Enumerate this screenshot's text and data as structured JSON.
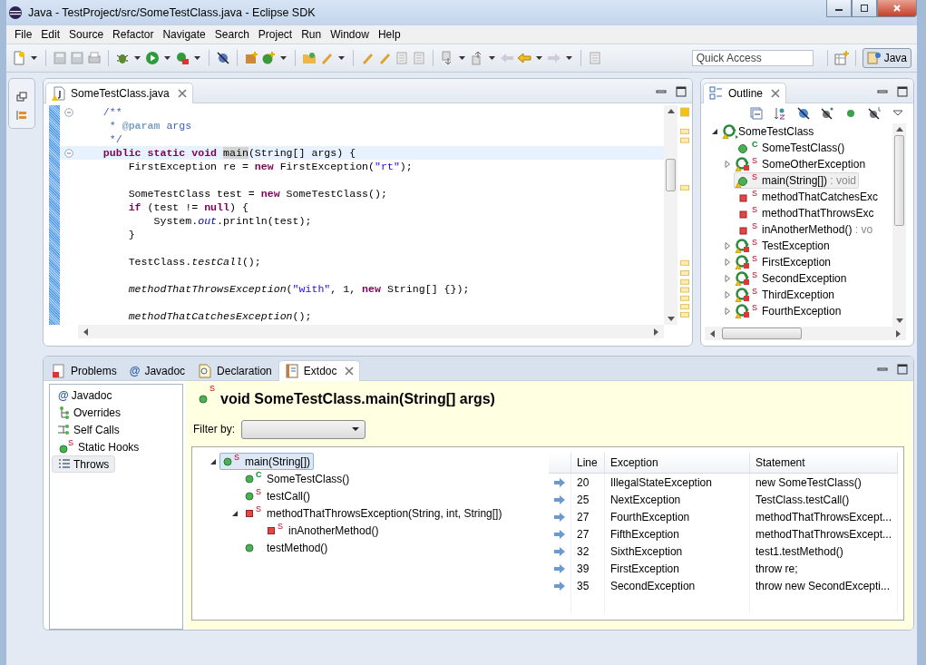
{
  "window": {
    "title": "Java - TestProject/src/SomeTestClass.java - Eclipse SDK"
  },
  "menu": [
    {
      "label": "File"
    },
    {
      "label": "Edit"
    },
    {
      "label": "Source"
    },
    {
      "label": "Refactor"
    },
    {
      "label": "Navigate"
    },
    {
      "label": "Search"
    },
    {
      "label": "Project"
    },
    {
      "label": "Run"
    },
    {
      "label": "Window"
    },
    {
      "label": "Help"
    }
  ],
  "quick_access": {
    "placeholder": "Quick Access"
  },
  "perspective": {
    "label": "Java",
    "selected": true
  },
  "editor": {
    "tab": {
      "label": "SomeTestClass.java",
      "selected": true,
      "warning": true
    },
    "lines": [
      {
        "fold": true,
        "current": false,
        "segments": [
          {
            "kind": "comment",
            "text": "    /**"
          }
        ]
      },
      {
        "current": false,
        "segments": [
          {
            "kind": "comment",
            "text": "     * "
          },
          {
            "kind": "tag",
            "text": "@param"
          },
          {
            "kind": "comment",
            "text": " args"
          }
        ]
      },
      {
        "current": false,
        "segments": [
          {
            "kind": "comment",
            "text": "     */"
          }
        ]
      },
      {
        "fold": true,
        "current": true,
        "segments": [
          {
            "kind": "keyword",
            "text": "    public static void "
          },
          {
            "kind": "plain",
            "text": "main",
            "occurrence": true
          },
          {
            "kind": "plain",
            "text": "(String[] args) {"
          }
        ]
      },
      {
        "current": false,
        "segments": [
          {
            "kind": "plain",
            "text": "        FirstException re = "
          },
          {
            "kind": "keyword",
            "text": "new"
          },
          {
            "kind": "plain",
            "text": " FirstException("
          },
          {
            "kind": "string",
            "text": "\"rt\""
          },
          {
            "kind": "plain",
            "text": ");"
          }
        ]
      },
      {
        "current": false
      },
      {
        "current": false,
        "segments": [
          {
            "kind": "plain",
            "text": "        SomeTestClass test = "
          },
          {
            "kind": "keyword",
            "text": "new"
          },
          {
            "kind": "plain",
            "text": " SomeTestClass();"
          }
        ]
      },
      {
        "current": false,
        "segments": [
          {
            "kind": "keyword",
            "text": "        if"
          },
          {
            "kind": "plain",
            "text": " (test != "
          },
          {
            "kind": "keyword",
            "text": "null"
          },
          {
            "kind": "plain",
            "text": ") {"
          }
        ]
      },
      {
        "current": false,
        "segments": [
          {
            "kind": "plain",
            "text": "            System."
          },
          {
            "kind": "field",
            "text": "out"
          },
          {
            "kind": "plain",
            "text": ".println(test);"
          }
        ]
      },
      {
        "current": false,
        "segments": [
          {
            "kind": "plain",
            "text": "        }"
          }
        ]
      },
      {
        "current": false
      },
      {
        "current": false,
        "segments": [
          {
            "kind": "plain",
            "text": "        TestClass."
          },
          {
            "kind": "static",
            "text": "testCall"
          },
          {
            "kind": "plain",
            "text": "();"
          }
        ]
      },
      {
        "current": false
      },
      {
        "current": false,
        "segments": [
          {
            "kind": "static",
            "text": "        methodThatThrowsException"
          },
          {
            "kind": "plain",
            "text": "("
          },
          {
            "kind": "string",
            "text": "\"with\""
          },
          {
            "kind": "plain",
            "text": ", 1, "
          },
          {
            "kind": "keyword",
            "text": "new"
          },
          {
            "kind": "plain",
            "text": " String[] {});"
          }
        ]
      },
      {
        "current": false
      },
      {
        "current": false,
        "segments": [
          {
            "kind": "static",
            "text": "        methodThatCatchesException"
          },
          {
            "kind": "plain",
            "text": "();"
          }
        ]
      }
    ]
  },
  "outline": {
    "title": "Outline",
    "items": [
      {
        "label": "SomeTestClass",
        "kind": "class",
        "warning": true,
        "selected": false,
        "expanded": true,
        "children": [
          {
            "label": "SomeTestClass()",
            "kind": "public",
            "badge": "C",
            "warning": false,
            "selected": false
          },
          {
            "label": "SomeOtherException",
            "kind": "type",
            "badge": "S",
            "warning": true,
            "selected": false,
            "expanded": false
          },
          {
            "label": "main(String[])",
            "suffix": " : void",
            "kind": "public",
            "badge": "S",
            "warning": true,
            "selected": true
          },
          {
            "label": "methodThatCatchesExc",
            "kind": "private",
            "badge": "S",
            "warning": false,
            "selected": false
          },
          {
            "label": "methodThatThrowsExc",
            "kind": "private",
            "badge": "S",
            "warning": false,
            "selected": false
          },
          {
            "label": "inAnotherMethod()",
            "suffix": " : vo",
            "kind": "private",
            "badge": "S",
            "warning": false,
            "selected": false
          },
          {
            "label": "TestException",
            "kind": "type",
            "badge": "S",
            "warning": true,
            "selected": false,
            "expanded": false
          },
          {
            "label": "FirstException",
            "kind": "type",
            "badge": "S",
            "warning": true,
            "selected": false,
            "expanded": false
          },
          {
            "label": "SecondException",
            "kind": "type",
            "badge": "S",
            "warning": true,
            "selected": false,
            "expanded": false
          },
          {
            "label": "ThirdException",
            "kind": "type",
            "badge": "S",
            "warning": true,
            "selected": false,
            "expanded": false
          },
          {
            "label": "FourthException",
            "kind": "type",
            "badge": "S",
            "warning": true,
            "selected": false,
            "expanded": false
          }
        ]
      }
    ]
  },
  "bottom": {
    "tabs": [
      {
        "label": "Problems",
        "kind": "problems",
        "selected": false
      },
      {
        "label": "Javadoc",
        "kind": "glyph",
        "glyph": "@",
        "selected": false
      },
      {
        "label": "Declaration",
        "kind": "declaration",
        "selected": false
      },
      {
        "label": "Extdoc",
        "kind": "extdoc",
        "selected": true
      }
    ],
    "views": [
      {
        "label": "Javadoc",
        "kind": "glyph",
        "glyph": "@",
        "selected": false
      },
      {
        "label": "Overrides",
        "kind": "hierarchy",
        "selected": false
      },
      {
        "label": "Self Calls",
        "kind": "calls",
        "selected": false
      },
      {
        "label": "Static Hooks",
        "kind": "hook",
        "badge": "S",
        "selected": false
      },
      {
        "label": "Throws",
        "kind": "list",
        "selected": true
      }
    ],
    "heading": {
      "kind": "public",
      "badge": "S",
      "text": "void SomeTestClass.main(String[] args)"
    },
    "filter": {
      "label": "Filter by:"
    },
    "tree": [
      {
        "label": "main(String[])",
        "kind": "public",
        "badge": "S",
        "selected": true,
        "expanded": true,
        "children": [
          {
            "label": "SomeTestClass()",
            "kind": "public",
            "badge": "C",
            "selected": false
          },
          {
            "label": "testCall()",
            "kind": "public",
            "badge": "S",
            "selected": false
          },
          {
            "label": "methodThatThrowsException(String, int, String[])",
            "kind": "private",
            "badge": "S",
            "selected": false,
            "expanded": true,
            "children": [
              {
                "label": "inAnotherMethod()",
                "kind": "private",
                "badge": "S",
                "selected": false
              }
            ]
          },
          {
            "label": "testMethod()",
            "kind": "public",
            "selected": false
          }
        ]
      }
    ],
    "table": {
      "columns": [
        "Line",
        "Exception",
        "Statement"
      ],
      "rows": [
        {
          "line": "20",
          "exception": "IllegalStateException",
          "statement": "new SomeTestClass()"
        },
        {
          "line": "25",
          "exception": "NextException",
          "statement": "TestClass.testCall()"
        },
        {
          "line": "27",
          "exception": "FourthException",
          "statement": "methodThatThrowsExcept..."
        },
        {
          "line": "27",
          "exception": "FifthException",
          "statement": "methodThatThrowsExcept..."
        },
        {
          "line": "32",
          "exception": "SixthException",
          "statement": "test1.testMethod()"
        },
        {
          "line": "39",
          "exception": "FirstException",
          "statement": "throw re;"
        },
        {
          "line": "35",
          "exception": "SecondException",
          "statement": "throw new SecondExcepti..."
        }
      ]
    }
  }
}
